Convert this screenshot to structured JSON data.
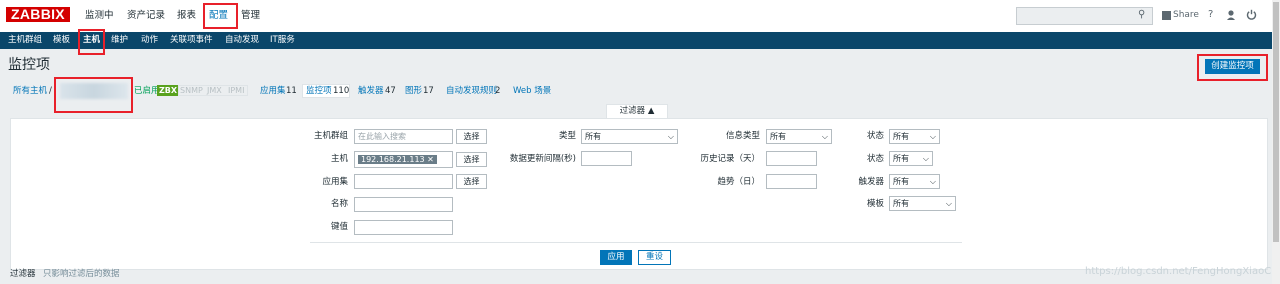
{
  "brand": "ZABBIX",
  "top_menu": [
    "监测中",
    "资产记录",
    "报表",
    "配置",
    "管理"
  ],
  "user_bar": {
    "share_label": "Share",
    "help_icon": "?",
    "user_icon": "user-icon",
    "logout_icon": "power-icon"
  },
  "sub_menu": [
    "主机群组",
    "模板",
    "主机",
    "维护",
    "动作",
    "关联项事件",
    "自动发现",
    "IT服务"
  ],
  "page_title": "监控项",
  "create_button": "创建监控项",
  "breadcrumb": {
    "all_hosts": "所有主机",
    "separator": "/",
    "host_name": "192.168.21.113",
    "status": "已启用",
    "zbx": "ZBX",
    "snmp": "SNMP",
    "jmx": "JMX",
    "ipmi": "IPMI",
    "app_label": "应用集",
    "app_count": "11",
    "items_label": "监控项",
    "items_count": "110",
    "triggers_label": "触发器",
    "triggers_count": "47",
    "graphs_label": "图形",
    "graphs_count": "17",
    "discovery_label": "自动发现规则",
    "discovery_count": "2",
    "web_label": "Web 场景"
  },
  "filter_tab": "过滤器 ▲",
  "filter": {
    "host_group": {
      "label": "主机群组",
      "placeholder": "在此输入搜索",
      "button": "选择"
    },
    "host": {
      "label": "主机",
      "chip": "192.168.21.113 ✕",
      "button": "选择"
    },
    "app": {
      "label": "应用集",
      "value": "",
      "button": "选择"
    },
    "name": {
      "label": "名称",
      "value": ""
    },
    "key": {
      "label": "键值",
      "value": ""
    },
    "type": {
      "label": "类型",
      "value": "所有"
    },
    "interval": {
      "label": "数据更新间隔(秒)",
      "value": ""
    },
    "info_type": {
      "label": "信息类型",
      "value": "所有"
    },
    "history": {
      "label": "历史记录（天）",
      "value": ""
    },
    "trends": {
      "label": "趋势（日）",
      "value": ""
    },
    "state1": {
      "label": "状态",
      "value": "所有"
    },
    "state2": {
      "label": "状态",
      "value": "所有"
    },
    "triggers": {
      "label": "触发器",
      "value": "所有"
    },
    "template": {
      "label": "模板",
      "value": "所有"
    },
    "apply": "应用",
    "reset": "重设"
  },
  "footer": {
    "label": "过滤器",
    "note": "只影响过滤后的数据"
  },
  "watermark": "https://blog.csdn.net/FengHongXiaoChen"
}
